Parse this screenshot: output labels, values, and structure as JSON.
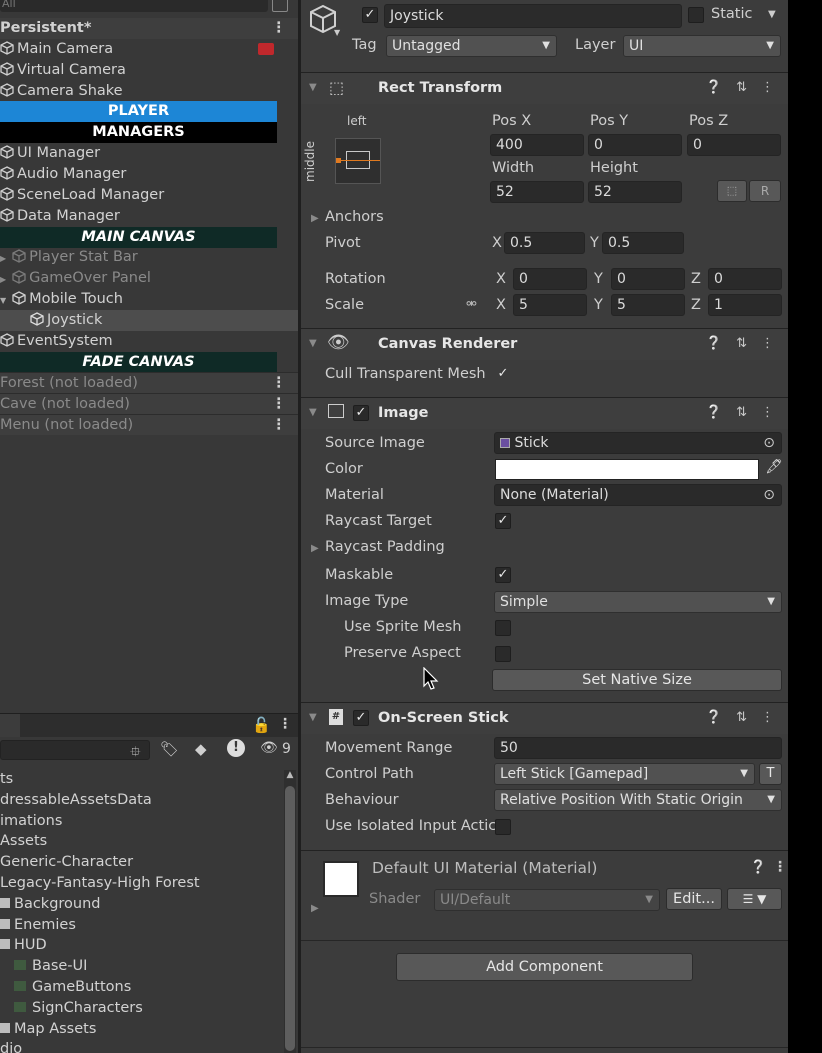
{
  "hierarchy": {
    "search_text": "All",
    "rows": [
      {
        "label": "Persistent*",
        "kind": "scene"
      },
      {
        "label": "Main Camera",
        "kind": "item"
      },
      {
        "label": "Virtual Camera",
        "kind": "item"
      },
      {
        "label": "Camera Shake",
        "kind": "item"
      },
      {
        "label": "PLAYER",
        "kind": "hdr-player"
      },
      {
        "label": "MANAGERS",
        "kind": "hdr-managers"
      },
      {
        "label": "UI Manager",
        "kind": "item"
      },
      {
        "label": "Audio Manager",
        "kind": "item"
      },
      {
        "label": "SceneLoad Manager",
        "kind": "item"
      },
      {
        "label": "Data Manager",
        "kind": "item"
      },
      {
        "label": "MAIN CANVAS",
        "kind": "hdr-canvas"
      },
      {
        "label": "Player Stat Bar",
        "kind": "dim-child"
      },
      {
        "label": "GameOver Panel",
        "kind": "dim-child"
      },
      {
        "label": "Mobile Touch",
        "kind": "child"
      },
      {
        "label": "Joystick",
        "kind": "selected"
      },
      {
        "label": "EventSystem",
        "kind": "item"
      },
      {
        "label": "FADE CANVAS",
        "kind": "hdr-canvas"
      },
      {
        "label": "Forest (not loaded)",
        "kind": "unloaded"
      },
      {
        "label": "Cave (not loaded)",
        "kind": "unloaded"
      },
      {
        "label": "Menu (not loaded)",
        "kind": "unloaded"
      }
    ]
  },
  "project": {
    "hidden_count": "9",
    "items": [
      {
        "label": "ts",
        "indent": 0
      },
      {
        "label": "dressableAssetsData",
        "indent": 0
      },
      {
        "label": "imations",
        "indent": 0
      },
      {
        "label": "Assets",
        "indent": 0
      },
      {
        "label": "Generic-Character",
        "indent": 0
      },
      {
        "label": "Legacy-Fantasy-High Forest",
        "indent": 0
      },
      {
        "label": "Background",
        "indent": 1
      },
      {
        "label": "Enemies",
        "indent": 1
      },
      {
        "label": "HUD",
        "indent": 1
      },
      {
        "label": "Base-UI",
        "indent": 2
      },
      {
        "label": "GameButtons",
        "indent": 2
      },
      {
        "label": "SignCharacters",
        "indent": 2
      },
      {
        "label": "Map Assets",
        "indent": 1
      },
      {
        "label": "dio",
        "indent": 0
      }
    ]
  },
  "inspector": {
    "name": "Joystick",
    "static_label": "Static",
    "tag_label": "Tag",
    "tag_value": "Untagged",
    "layer_label": "Layer",
    "layer_value": "UI",
    "rect": {
      "title": "Rect Transform",
      "anchor_h": "left",
      "anchor_v": "middle",
      "posx_label": "Pos X",
      "posy_label": "Pos Y",
      "posz_label": "Pos Z",
      "posx": "400",
      "posy": "0",
      "posz": "0",
      "width_label": "Width",
      "height_label": "Height",
      "width": "52",
      "height": "52",
      "r_btn": "R",
      "anchors_label": "Anchors",
      "pivot_label": "Pivot",
      "pivot_x": "0.5",
      "pivot_y": "0.5",
      "rotation_label": "Rotation",
      "rot_x": "0",
      "rot_y": "0",
      "rot_z": "0",
      "scale_label": "Scale",
      "scale_x": "5",
      "scale_y": "5",
      "scale_z": "1",
      "x": "X",
      "y": "Y",
      "z": "Z"
    },
    "canvas_renderer": {
      "title": "Canvas Renderer",
      "cull_label": "Cull Transparent Mesh"
    },
    "image": {
      "title": "Image",
      "source_label": "Source Image",
      "source_value": "Stick",
      "color_label": "Color",
      "color_value": "#ffffff",
      "material_label": "Material",
      "material_value": "None (Material)",
      "raycast_label": "Raycast Target",
      "padding_label": "Raycast Padding",
      "maskable_label": "Maskable",
      "type_label": "Image Type",
      "type_value": "Simple",
      "sprite_mesh_label": "Use Sprite Mesh",
      "preserve_label": "Preserve Aspect",
      "native_btn": "Set Native Size"
    },
    "stick": {
      "title": "On-Screen Stick",
      "range_label": "Movement Range",
      "range_value": "50",
      "path_label": "Control Path",
      "path_value": "Left Stick [Gamepad]",
      "t_btn": "T",
      "behaviour_label": "Behaviour",
      "behaviour_value": "Relative Position With Static Origin",
      "isolated_label": "Use Isolated Input Actic"
    },
    "material": {
      "title": "Default UI Material (Material)",
      "shader_label": "Shader",
      "shader_value": "UI/Default",
      "edit_btn": "Edit..."
    },
    "add_component": "Add Component"
  }
}
